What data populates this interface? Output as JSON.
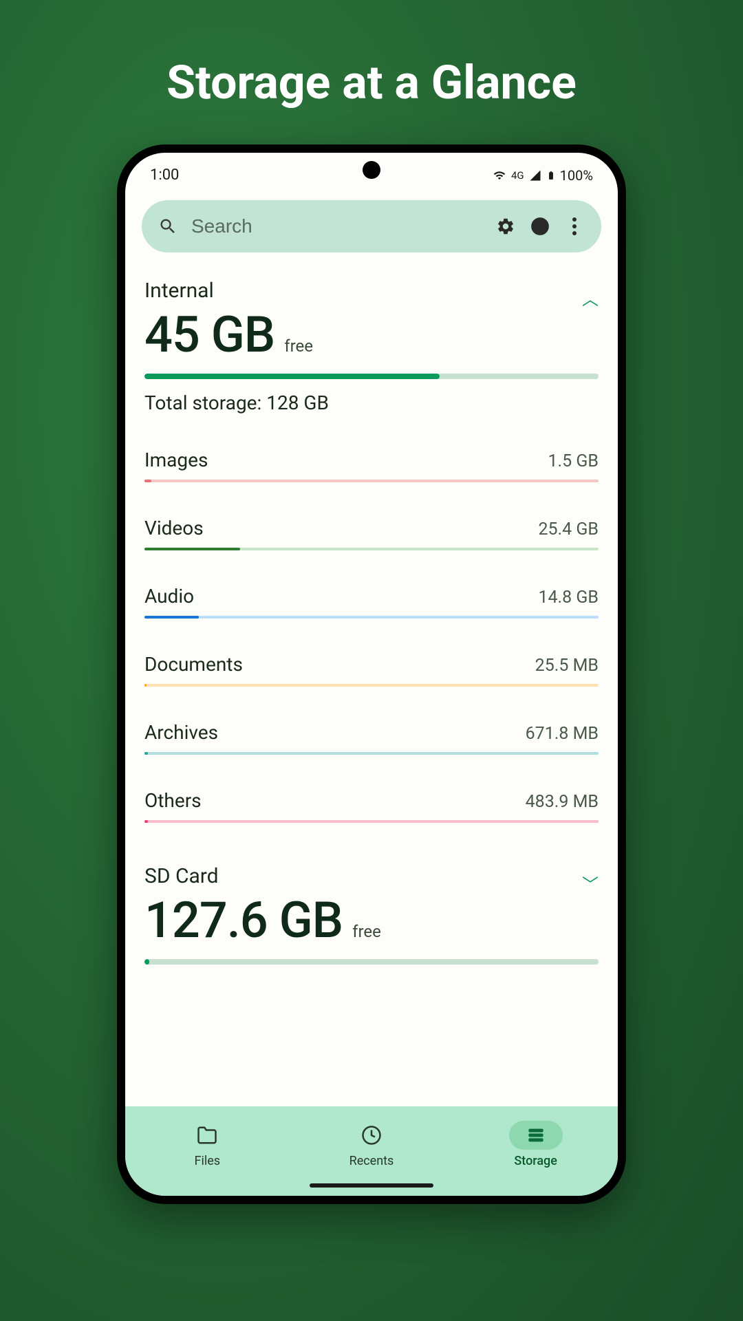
{
  "page_title": "Storage at a Glance",
  "status_bar": {
    "time": "1:00",
    "network": "4G",
    "battery": "100%"
  },
  "search": {
    "placeholder": "Search"
  },
  "internal": {
    "name": "Internal",
    "free_value": "45 GB",
    "free_label": "free",
    "total_label": "Total storage: 128 GB",
    "used_percent": 65,
    "categories": [
      {
        "name": "Images",
        "size": "1.5 GB",
        "color": "#e57373",
        "bg": "#f5c6c6",
        "fill": 1.5
      },
      {
        "name": "Videos",
        "size": "25.4 GB",
        "color": "#2e7d32",
        "bg": "#c8e6c9",
        "fill": 21
      },
      {
        "name": "Audio",
        "size": "14.8 GB",
        "color": "#1976d2",
        "bg": "#bbdefb",
        "fill": 12
      },
      {
        "name": "Documents",
        "size": "25.5 MB",
        "color": "#ffa726",
        "bg": "#ffe0b2",
        "fill": 0.5
      },
      {
        "name": "Archives",
        "size": "671.8 MB",
        "color": "#26a69a",
        "bg": "#b2dfdb",
        "fill": 0.8
      },
      {
        "name": "Others",
        "size": "483.9 MB",
        "color": "#ec407a",
        "bg": "#f8bbd0",
        "fill": 0.7
      }
    ]
  },
  "sdcard": {
    "name": "SD Card",
    "free_value": "127.6 GB",
    "free_label": "free"
  },
  "nav": {
    "items": [
      {
        "label": "Files",
        "icon": "folder"
      },
      {
        "label": "Recents",
        "icon": "clock"
      },
      {
        "label": "Storage",
        "icon": "storage"
      }
    ],
    "active": 2
  }
}
